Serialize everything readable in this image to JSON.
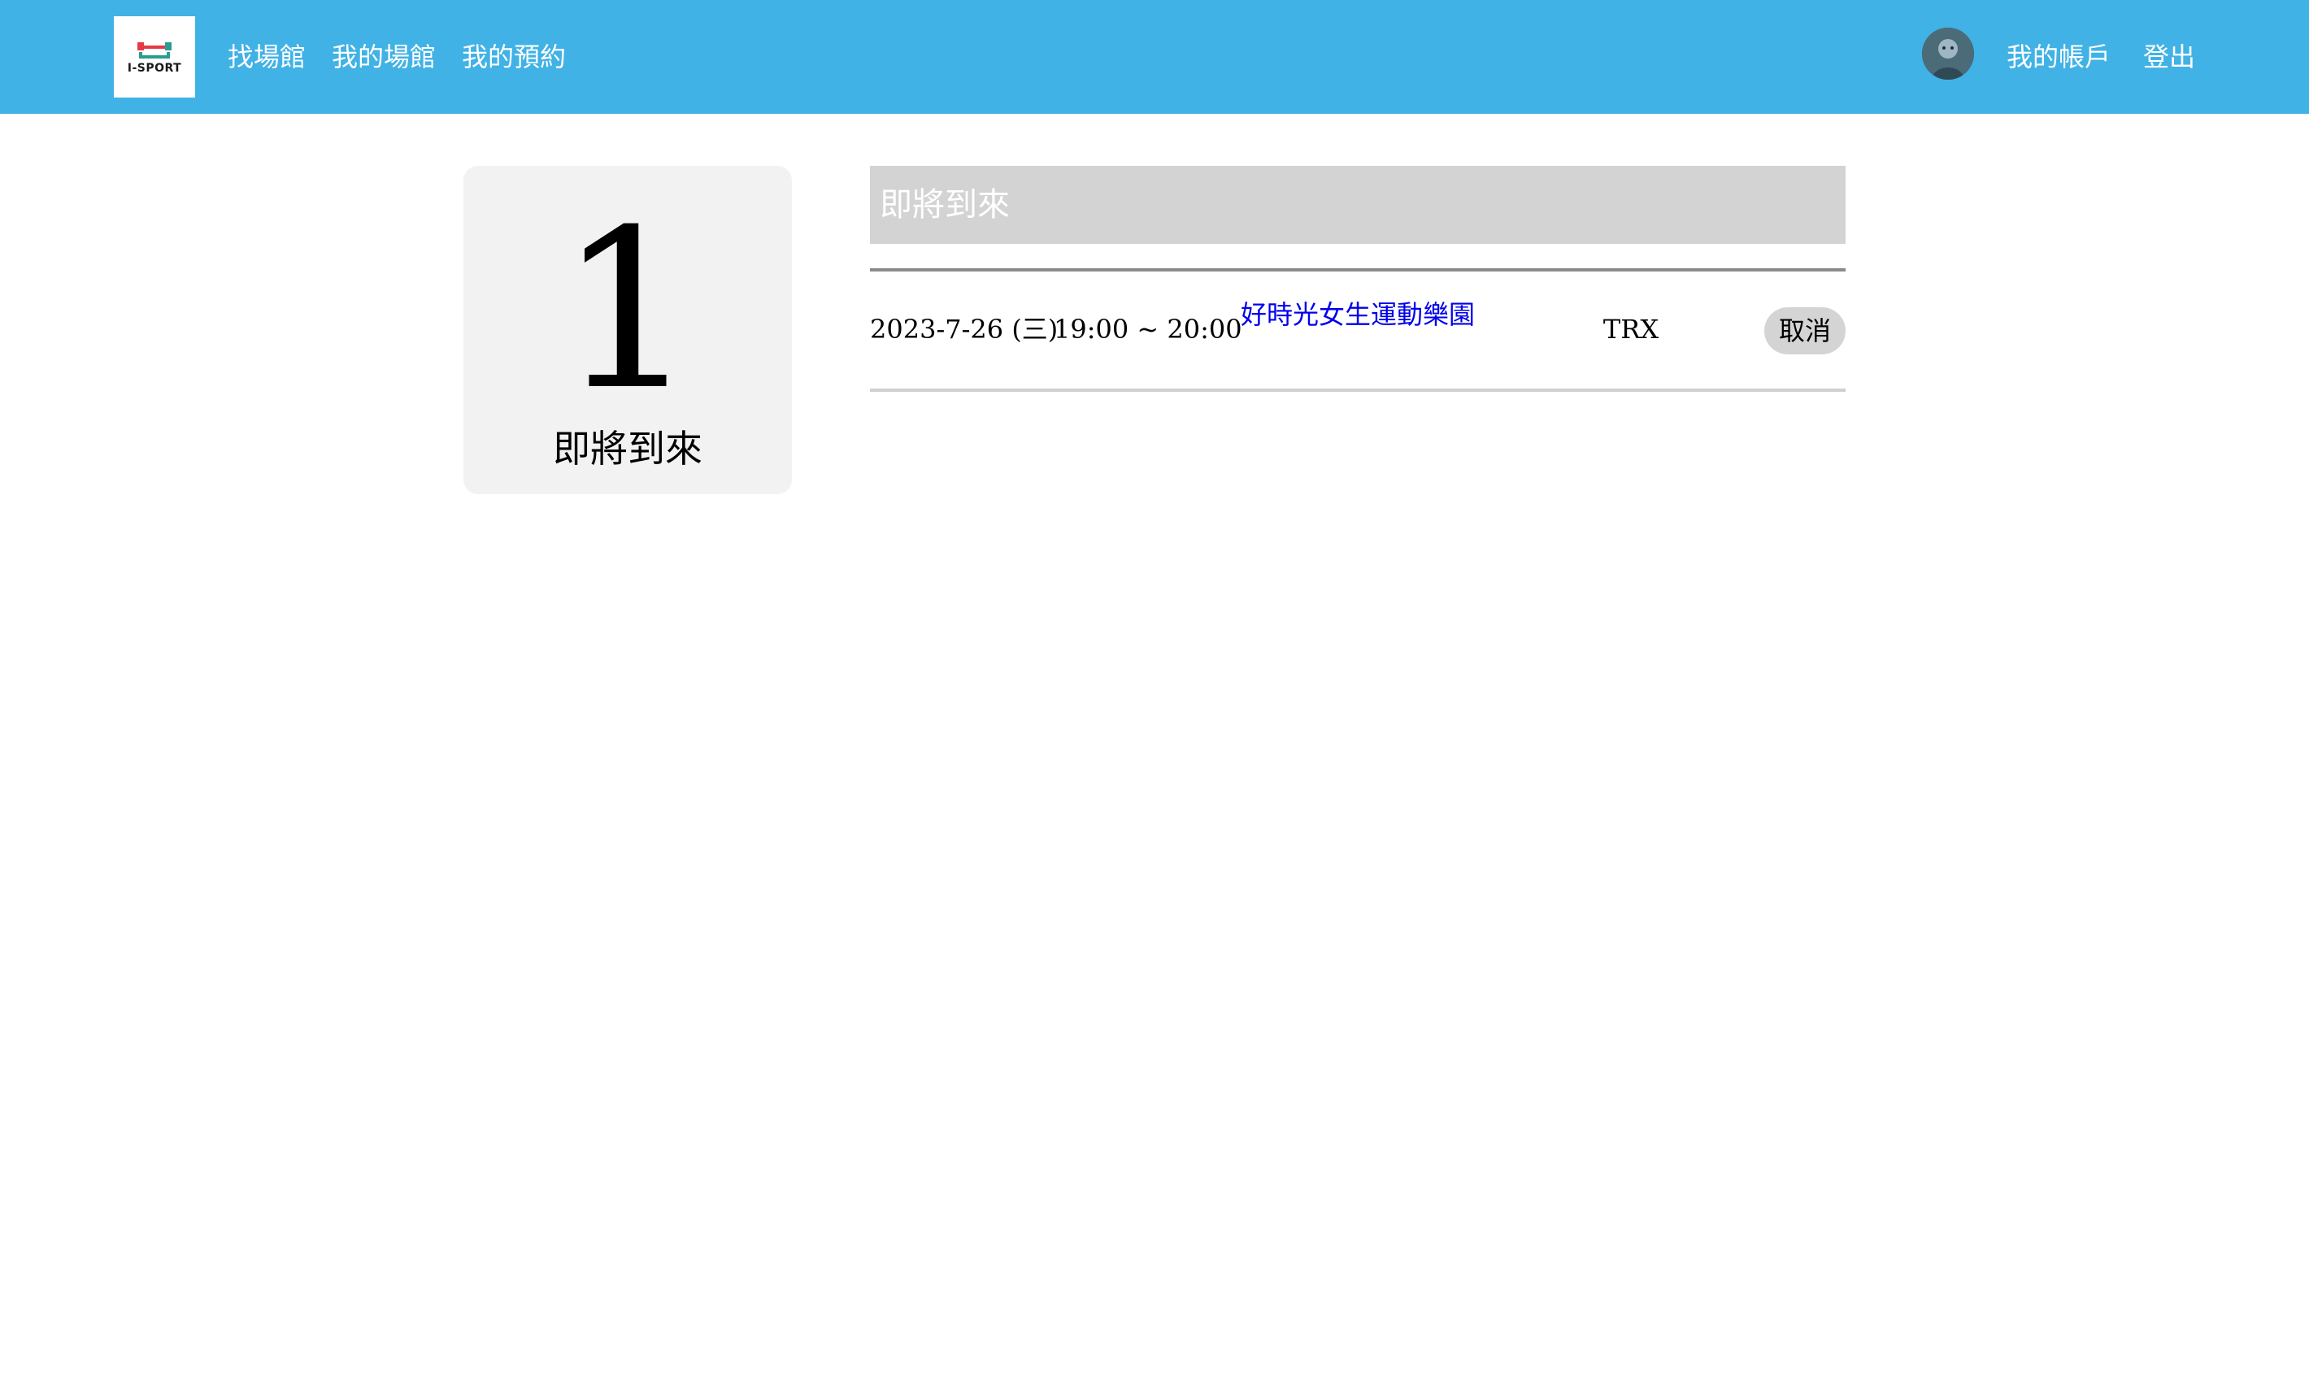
{
  "colors": {
    "nav_background": "#40b2e6",
    "venue_link": "#0000ee",
    "card_background": "#f3f2f2",
    "section_header_background": "#d3d3d3"
  },
  "navbar": {
    "logo_text": "I-SPORT",
    "left_links": [
      "找場館",
      "我的場館",
      "我的預約"
    ],
    "avatar_icon": "user-avatar",
    "right_links": [
      "我的帳戶",
      "登出"
    ]
  },
  "summary_card": {
    "count": "1",
    "label": "即將到來"
  },
  "bookings_section": {
    "title": "即將到來",
    "rows": [
      {
        "date": "2023-7-26 (三)",
        "time": "19:00 ~ 20:00",
        "venue": "好時光女生運動樂園",
        "course": "TRX",
        "action": "取消"
      }
    ]
  }
}
